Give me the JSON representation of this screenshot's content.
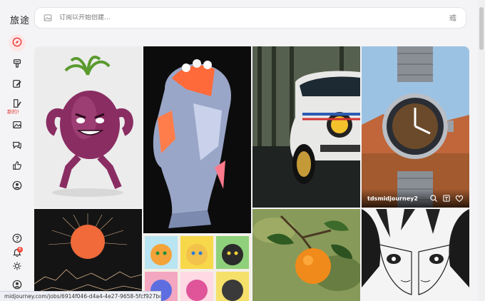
{
  "brand": "旅途",
  "sidebar": {
    "items": [
      {
        "name": "explore",
        "icon": "compass-icon"
      },
      {
        "name": "create",
        "icon": "brush-icon"
      },
      {
        "name": "edit",
        "icon": "pencil-icon"
      },
      {
        "name": "new-feature",
        "icon": "book-edit-icon",
        "badge": "新的!"
      },
      {
        "name": "images",
        "icon": "image-icon"
      },
      {
        "name": "chat",
        "icon": "chat-icon"
      },
      {
        "name": "likes",
        "icon": "thumbs-up-icon"
      },
      {
        "name": "profile",
        "icon": "user-icon"
      }
    ],
    "bottom": [
      {
        "name": "help",
        "icon": "help-icon"
      },
      {
        "name": "notifications",
        "icon": "bell-icon",
        "count": "6"
      },
      {
        "name": "theme",
        "icon": "sun-icon"
      },
      {
        "name": "account",
        "icon": "account-icon"
      }
    ]
  },
  "search": {
    "placeholder": "订阅以开始创建..."
  },
  "gallery": {
    "items": [
      {
        "subject": "onion-character"
      },
      {
        "subject": "statue-head"
      },
      {
        "subject": "car-front"
      },
      {
        "subject": "wristwatch",
        "user": "tdsmidjourney2"
      },
      {
        "subject": "sun-desert"
      },
      {
        "subject": "cat-portraits"
      },
      {
        "subject": "orange-fruit"
      },
      {
        "subject": "manga-faces"
      }
    ]
  },
  "status_url": "midjourney.com/jobs/6914f046-d4a4-4e27-9658-5fcf927bcc7..."
}
